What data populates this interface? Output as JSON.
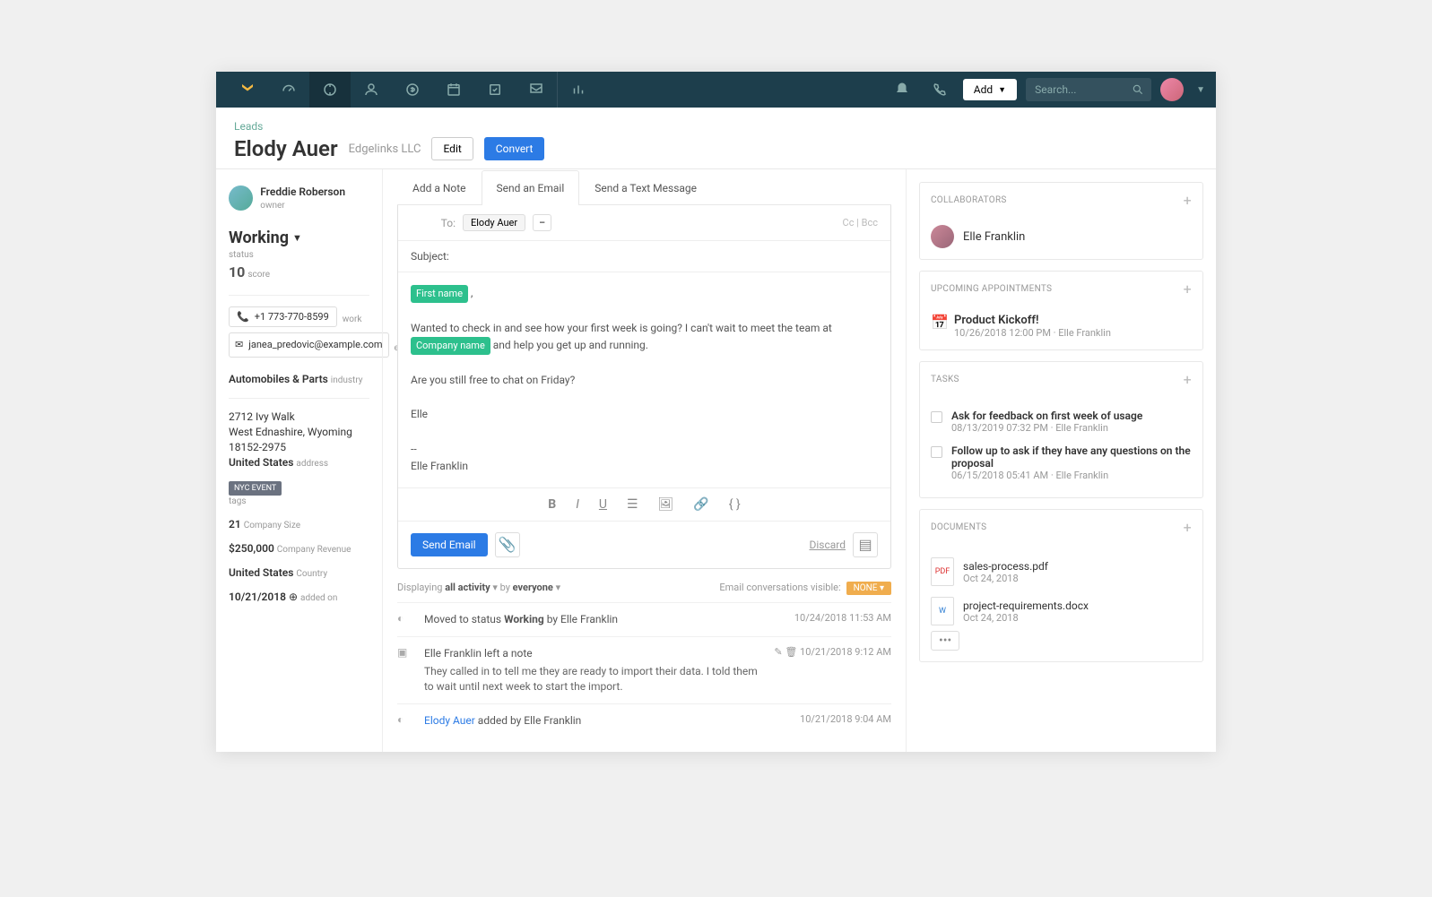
{
  "topbar": {
    "add_label": "Add",
    "search_placeholder": "Search..."
  },
  "header": {
    "breadcrumb": "Leads",
    "name": "Elody Auer",
    "company": "Edgelinks LLC",
    "edit_label": "Edit",
    "convert_label": "Convert"
  },
  "owner": {
    "name": "Freddie Roberson",
    "label": "owner"
  },
  "status": {
    "title": "Working",
    "sublabel": "status"
  },
  "score": {
    "value": "10",
    "label": "score"
  },
  "contact": {
    "phone": "+1 773-770-8599",
    "phone_label": "work",
    "email": "janea_predovic@example.com",
    "email_label": "email"
  },
  "industry": {
    "value": "Automobiles & Parts",
    "label": "industry"
  },
  "address": {
    "line1": "2712 Ivy Walk",
    "line2": "West Ednashire, Wyoming 18152-2975",
    "country": "United States",
    "label": "address"
  },
  "tag": {
    "value": "NYC EVENT",
    "label": "tags"
  },
  "company_size": {
    "value": "21",
    "label": "Company Size"
  },
  "revenue": {
    "value": "$250,000",
    "label": "Company Revenue"
  },
  "country_field": {
    "value": "United States",
    "label": "Country"
  },
  "added": {
    "value": "10/21/2018",
    "label": "added on"
  },
  "tabs": {
    "note": "Add a Note",
    "email": "Send an Email",
    "text": "Send a Text Message"
  },
  "email": {
    "to_label": "To:",
    "to_chip": "Elody Auer",
    "chip_extra": "–",
    "cc": "Cc",
    "bcc": "Bcc",
    "subject_label": "Subject:",
    "merge_first": "First name",
    "body1": "Wanted to check in and see how your first week is going? I can't wait to meet the team at ",
    "merge_company": "Company name",
    "body2": " and help you get up and running.",
    "body3": "Are you still free to chat on Friday?",
    "body4": "Elle",
    "sig_dash": "--",
    "sig_name": "Elle Franklin",
    "send_label": "Send Email",
    "discard_label": "Discard"
  },
  "filter": {
    "prefix": "Displaying ",
    "activity": "all activity",
    "by": " by ",
    "who": "everyone",
    "vis_label": "Email conversations visible:",
    "vis_value": "NONE"
  },
  "activity": [
    {
      "text1": "Moved to status ",
      "bold": "Working",
      "text2": " by Elle Franklin",
      "time": "10/24/2018 11:53 AM"
    },
    {
      "head": "Elle Franklin left a note",
      "body": "They called in to tell me they are ready to import their data. I told them to wait until next week to start the import.",
      "time": "10/21/2018 9:12 AM"
    },
    {
      "link": "Elody Auer",
      "text": " added by Elle Franklin",
      "time": "10/21/2018 9:04 AM"
    }
  ],
  "collab": {
    "title": "Collaborators",
    "name": "Elle Franklin"
  },
  "appt": {
    "title": "Upcoming Appointments",
    "name": "Product Kickoff!",
    "sub": "10/26/2018 12:00 PM · Elle Franklin"
  },
  "tasks_panel": {
    "title": "Tasks",
    "items": [
      {
        "title": "Ask for feedback on first week of usage",
        "sub": "08/13/2019 07:32 PM · Elle Franklin"
      },
      {
        "title": "Follow up to ask if they have any questions on the proposal",
        "sub": "06/15/2018 05:41 AM · Elle Franklin"
      }
    ]
  },
  "docs": {
    "title": "Documents",
    "items": [
      {
        "name": "sales-process.pdf",
        "date": "Oct 24, 2018",
        "type": "pdf"
      },
      {
        "name": "project-requirements.docx",
        "date": "Oct 24, 2018",
        "type": "word"
      }
    ]
  }
}
